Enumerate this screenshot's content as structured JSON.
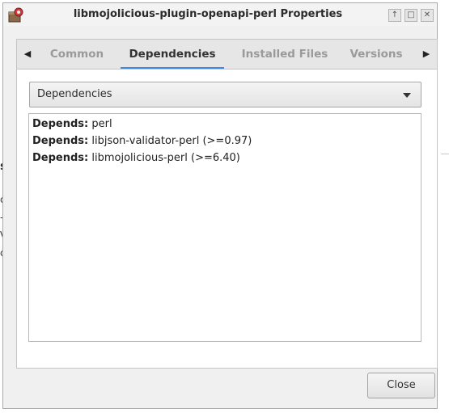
{
  "window": {
    "title": "libmojolicious-plugin-openapi-perl Properties",
    "controls": [
      "↑",
      "□",
      "✕"
    ]
  },
  "tabs": [
    {
      "label": "Common",
      "active": false
    },
    {
      "label": "Dependencies",
      "active": true
    },
    {
      "label": "Installed Files",
      "active": false
    },
    {
      "label": "Versions",
      "active": false
    }
  ],
  "dependencies": {
    "combo_value": "Dependencies",
    "items": [
      {
        "kind": "Depends:",
        "package": " perl"
      },
      {
        "kind": "Depends:",
        "package": " libjson-validator-perl (>=0.97)"
      },
      {
        "kind": "Depends:",
        "package": " libmojolicious-perl (>=6.40)"
      }
    ]
  },
  "close_label": "Close",
  "background_fragments": [
    "s",
    "c",
    "-",
    "V",
    "c"
  ],
  "colors": {
    "accent": "#3f8ae0",
    "dialog_bg": "#f0f0f0"
  }
}
